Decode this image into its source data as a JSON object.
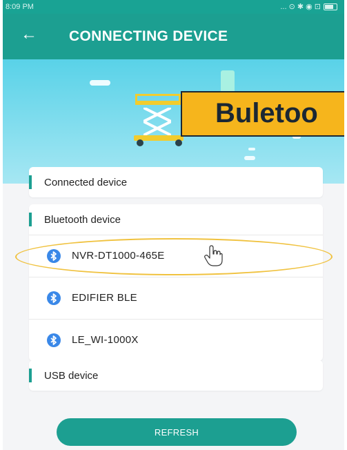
{
  "statusbar": {
    "time": "8:09 PM",
    "icons": "... ⊙ ✱ ◉ ⊡"
  },
  "appbar": {
    "back_icon": "arrow-left-icon",
    "title": "CONNECTING DEVICE"
  },
  "banner": {
    "label_text": "Buletoo"
  },
  "sections": {
    "connected": {
      "title": "Connected device"
    },
    "bluetooth": {
      "title": "Bluetooth device",
      "devices": [
        {
          "name": "NVR-DT1000-465E",
          "icon": "bluetooth-icon"
        },
        {
          "name": "EDIFIER BLE",
          "icon": "bluetooth-icon"
        },
        {
          "name": "LE_WI-1000X",
          "icon": "bluetooth-icon"
        }
      ]
    },
    "usb": {
      "title": "USB device"
    }
  },
  "footer": {
    "refresh_label": "REFRESH"
  },
  "colors": {
    "primary": "#1c9f91",
    "bluetooth": "#3a88e8",
    "highlight": "#f0c23f",
    "banner_label": "#f6b51c"
  }
}
